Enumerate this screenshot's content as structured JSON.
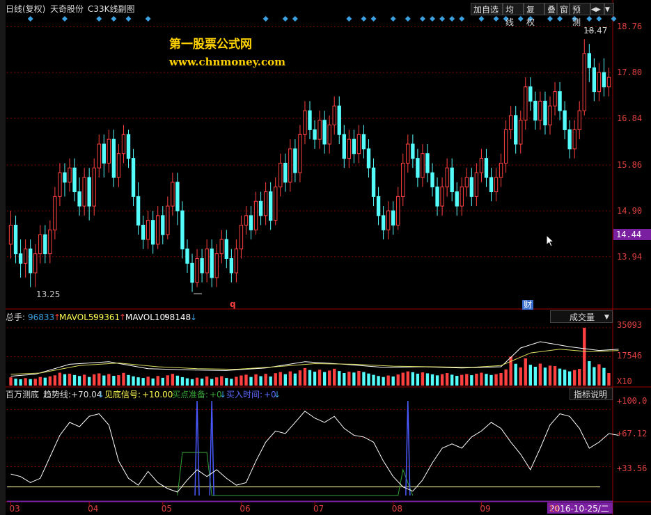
{
  "header": {
    "mode": "日线(复权)",
    "stock": "天奇股份",
    "indicator": "C33K线副图",
    "buttons": [
      "加自选",
      "均线",
      "复权",
      "叠",
      "窗",
      "预测"
    ],
    "nav_glyph": "◀▶"
  },
  "watermark": {
    "line1": "第一股票公式网",
    "line2": "www.chnmoney.com"
  },
  "price_axis": {
    "ticks": [
      "18.76",
      "17.80",
      "16.84",
      "15.86",
      "14.90",
      "13.94"
    ],
    "current": "14.44"
  },
  "annotations": {
    "high": "18.47",
    "low": "13.25",
    "q_mark": "q",
    "cai_mark": "财"
  },
  "volume_panel": {
    "label_total": "总手:",
    "total": "96833",
    "total_arrow": "↑",
    "ma5_label": "MAVOL5:",
    "ma5": "99361",
    "ma5_arrow": "↑",
    "ma10_label": "MAVOL10:",
    "ma10": "98148",
    "ma10_arrow": "↓",
    "dropdown": "成交量",
    "ticks": [
      "35093",
      "17546"
    ],
    "unit": "X10"
  },
  "indicator_panel": {
    "name": "百万测底",
    "trend_label": "趋势线:",
    "trend": "+70.04",
    "trend_arrow": "↓",
    "signal_label": "见底信号:",
    "signal": "+10.00",
    "ready_label": "买点准备:",
    "ready": "+0",
    "ready_arrow": "↓",
    "buy_label": "买入时间:",
    "buy": "+0",
    "buy_arrow": "↓",
    "help": "指标说明",
    "ticks": [
      "+100.0",
      "+67.12",
      "+33.56"
    ]
  },
  "time_axis": {
    "months": [
      "03",
      "04",
      "05",
      "06",
      "07",
      "08",
      "09",
      "10"
    ],
    "current_date": "2016-10-25/二"
  },
  "colors": {
    "up": "#ff4040",
    "down": "#54fcfc",
    "grid": "#7a0000",
    "signal": "#3ba0e0",
    "axis_text": "#e04040",
    "date_bg": "#7a1fa0"
  },
  "chart_data": {
    "type": "candlestick",
    "y_range": [
      12.9,
      19.0
    ],
    "price_ticks": [
      18.76,
      17.8,
      16.84,
      15.86,
      14.9,
      13.94
    ],
    "high": 18.47,
    "low": 13.25,
    "last": 14.44,
    "candles": [
      [
        14.2,
        14.6,
        14.9,
        13.9
      ],
      [
        14.6,
        14.0,
        14.8,
        13.8
      ],
      [
        14.0,
        13.8,
        14.3,
        13.5
      ],
      [
        13.8,
        14.1,
        14.3,
        13.5
      ],
      [
        14.1,
        13.6,
        14.3,
        13.3
      ],
      [
        13.6,
        14.0,
        14.2,
        13.3
      ],
      [
        14.0,
        14.4,
        14.6,
        13.8
      ],
      [
        14.4,
        14.0,
        14.6,
        13.8
      ],
      [
        14.0,
        14.5,
        14.7,
        13.8
      ],
      [
        14.5,
        15.2,
        15.4,
        14.3
      ],
      [
        15.2,
        15.7,
        15.9,
        15.0
      ],
      [
        15.7,
        15.5,
        15.9,
        15.2
      ],
      [
        15.5,
        15.8,
        16.0,
        15.3
      ],
      [
        15.8,
        15.3,
        16.0,
        15.1
      ],
      [
        15.3,
        15.0,
        15.6,
        14.8
      ],
      [
        15.0,
        15.6,
        15.8,
        14.8
      ],
      [
        15.6,
        15.0,
        15.8,
        14.7
      ],
      [
        15.0,
        15.8,
        16.0,
        14.8
      ],
      [
        15.8,
        16.3,
        16.5,
        15.6
      ],
      [
        16.3,
        15.9,
        16.5,
        15.6
      ],
      [
        15.9,
        16.4,
        16.6,
        15.7
      ],
      [
        16.4,
        15.6,
        16.6,
        15.4
      ],
      [
        15.6,
        16.1,
        16.3,
        15.4
      ],
      [
        16.1,
        16.5,
        16.7,
        15.9
      ],
      [
        16.5,
        16.0,
        16.6,
        15.8
      ],
      [
        16.0,
        15.2,
        16.2,
        15.0
      ],
      [
        15.2,
        14.6,
        15.5,
        14.4
      ],
      [
        14.6,
        14.3,
        14.8,
        14.1
      ],
      [
        14.3,
        14.7,
        14.9,
        14.1
      ],
      [
        14.7,
        14.2,
        14.9,
        14.0
      ],
      [
        14.2,
        14.8,
        15.0,
        14.1
      ],
      [
        14.8,
        14.4,
        15.0,
        14.2
      ],
      [
        14.4,
        15.0,
        15.2,
        14.3
      ],
      [
        15.0,
        15.5,
        15.7,
        14.8
      ],
      [
        15.5,
        14.9,
        15.7,
        14.6
      ],
      [
        14.9,
        14.1,
        15.1,
        13.9
      ],
      [
        14.1,
        13.8,
        14.3,
        13.6
      ],
      [
        13.8,
        13.4,
        14.0,
        13.2
      ],
      [
        13.4,
        13.9,
        14.1,
        13.3
      ],
      [
        13.9,
        13.6,
        14.1,
        13.4
      ],
      [
        13.6,
        14.1,
        14.3,
        13.4
      ],
      [
        14.1,
        13.5,
        14.3,
        13.3
      ],
      [
        13.5,
        14.0,
        14.2,
        13.3
      ],
      [
        14.0,
        14.3,
        14.5,
        13.8
      ],
      [
        14.3,
        13.9,
        14.5,
        13.7
      ],
      [
        13.9,
        13.6,
        14.1,
        13.4
      ],
      [
        13.6,
        14.1,
        14.3,
        13.4
      ],
      [
        14.1,
        14.6,
        14.8,
        13.9
      ],
      [
        14.6,
        14.8,
        15.0,
        14.4
      ],
      [
        14.8,
        14.5,
        15.0,
        14.3
      ],
      [
        14.5,
        15.1,
        15.3,
        14.4
      ],
      [
        15.1,
        14.8,
        15.3,
        14.6
      ],
      [
        14.8,
        15.3,
        15.5,
        14.6
      ],
      [
        15.3,
        14.7,
        15.5,
        14.5
      ],
      [
        14.7,
        15.4,
        15.6,
        14.6
      ],
      [
        15.4,
        15.9,
        16.1,
        15.2
      ],
      [
        15.9,
        15.5,
        16.1,
        15.3
      ],
      [
        15.5,
        16.2,
        16.4,
        15.3
      ],
      [
        16.2,
        15.7,
        16.4,
        15.5
      ],
      [
        15.7,
        16.5,
        16.7,
        15.5
      ],
      [
        16.5,
        17.0,
        17.2,
        16.3
      ],
      [
        17.0,
        16.6,
        17.2,
        16.4
      ],
      [
        16.6,
        16.4,
        16.8,
        16.2
      ],
      [
        16.4,
        16.8,
        17.0,
        16.2
      ],
      [
        16.8,
        16.3,
        17.0,
        16.1
      ],
      [
        16.3,
        16.7,
        16.9,
        16.1
      ],
      [
        16.7,
        17.1,
        17.3,
        16.5
      ],
      [
        17.1,
        16.5,
        17.3,
        16.3
      ],
      [
        16.5,
        16.0,
        16.7,
        15.8
      ],
      [
        16.0,
        16.4,
        16.6,
        15.8
      ],
      [
        16.4,
        16.1,
        16.6,
        15.9
      ],
      [
        16.1,
        16.5,
        16.7,
        15.9
      ],
      [
        16.5,
        16.2,
        16.7,
        16.0
      ],
      [
        16.2,
        15.8,
        16.4,
        15.6
      ],
      [
        15.8,
        15.2,
        16.0,
        15.0
      ],
      [
        15.2,
        14.8,
        15.4,
        14.6
      ],
      [
        14.8,
        14.5,
        15.0,
        14.3
      ],
      [
        14.5,
        14.9,
        15.1,
        14.3
      ],
      [
        14.9,
        14.6,
        15.1,
        14.4
      ],
      [
        14.6,
        15.2,
        15.4,
        14.5
      ],
      [
        15.2,
        15.9,
        16.1,
        15.0
      ],
      [
        15.9,
        16.3,
        16.5,
        15.7
      ],
      [
        16.3,
        16.0,
        16.5,
        15.8
      ],
      [
        16.0,
        15.6,
        16.2,
        15.4
      ],
      [
        15.6,
        16.1,
        16.3,
        15.4
      ],
      [
        16.1,
        15.7,
        16.3,
        15.5
      ],
      [
        15.7,
        15.4,
        15.9,
        15.2
      ],
      [
        15.4,
        15.0,
        15.6,
        14.8
      ],
      [
        15.0,
        15.4,
        15.6,
        14.8
      ],
      [
        15.4,
        15.8,
        16.0,
        15.2
      ],
      [
        15.8,
        15.3,
        16.0,
        15.1
      ],
      [
        15.3,
        15.0,
        15.5,
        14.8
      ],
      [
        15.0,
        15.4,
        15.6,
        14.8
      ],
      [
        15.4,
        15.6,
        15.8,
        15.2
      ],
      [
        15.6,
        15.2,
        15.8,
        15.0
      ],
      [
        15.2,
        15.7,
        15.9,
        15.0
      ],
      [
        15.7,
        16.0,
        16.2,
        15.5
      ],
      [
        16.0,
        15.6,
        16.2,
        15.4
      ],
      [
        15.6,
        15.3,
        15.8,
        15.1
      ],
      [
        15.3,
        15.6,
        15.8,
        15.1
      ],
      [
        15.6,
        15.9,
        16.1,
        15.4
      ],
      [
        15.9,
        16.6,
        16.8,
        15.7
      ],
      [
        16.6,
        16.9,
        17.1,
        16.4
      ],
      [
        16.9,
        16.3,
        17.1,
        16.1
      ],
      [
        16.3,
        16.8,
        17.0,
        16.1
      ],
      [
        16.8,
        17.5,
        17.7,
        16.6
      ],
      [
        17.5,
        17.2,
        17.7,
        17.0
      ],
      [
        17.2,
        16.8,
        17.4,
        16.6
      ],
      [
        16.8,
        17.2,
        17.4,
        16.6
      ],
      [
        17.2,
        16.7,
        17.4,
        16.5
      ],
      [
        16.7,
        17.1,
        17.3,
        16.5
      ],
      [
        17.1,
        17.4,
        17.6,
        16.9
      ],
      [
        17.4,
        17.0,
        17.6,
        16.8
      ],
      [
        17.0,
        16.6,
        17.2,
        16.4
      ],
      [
        16.6,
        16.2,
        16.8,
        16.0
      ],
      [
        16.2,
        16.6,
        16.8,
        16.0
      ],
      [
        16.6,
        17.0,
        17.2,
        16.4
      ],
      [
        17.0,
        18.2,
        18.5,
        16.9
      ],
      [
        18.2,
        17.9,
        18.4,
        17.6
      ],
      [
        17.9,
        17.4,
        18.1,
        17.2
      ],
      [
        17.4,
        17.8,
        18.0,
        17.2
      ],
      [
        17.8,
        17.5,
        18.1,
        17.3
      ],
      [
        17.5,
        17.7,
        17.9,
        17.3
      ]
    ],
    "volume": {
      "ticks": [
        35093,
        17546
      ],
      "unit": "X10",
      "y_max": 38000,
      "values": [
        5000,
        4200,
        3800,
        4500,
        3900,
        4100,
        5200,
        4800,
        5600,
        6200,
        7800,
        6900,
        7200,
        6400,
        5800,
        6600,
        5200,
        6800,
        7400,
        6100,
        7000,
        5900,
        6300,
        7700,
        6400,
        5600,
        5000,
        4600,
        5400,
        4300,
        5800,
        4700,
        6200,
        7100,
        6000,
        5100,
        4400,
        3900,
        4800,
        4200,
        5500,
        4000,
        5000,
        5700,
        4600,
        4100,
        5300,
        6100,
        6600,
        5200,
        6800,
        5700,
        7100,
        5500,
        7500,
        8200,
        6900,
        8600,
        7300,
        9200,
        10600,
        9400,
        8400,
        9600,
        8200,
        9100,
        10200,
        8800,
        7600,
        8400,
        7900,
        8900,
        8200,
        7300,
        6500,
        5800,
        5200,
        6100,
        5500,
        6700,
        7800,
        8600,
        8100,
        7200,
        8000,
        7400,
        6800,
        6200,
        6900,
        7600,
        6600,
        5900,
        6500,
        7000,
        6300,
        7200,
        7800,
        7100,
        6400,
        6900,
        7600,
        9800,
        17500,
        13200,
        11000,
        16500,
        12600,
        11400,
        13300,
        10900,
        12100,
        11800,
        10300,
        9600,
        8600,
        9400,
        10100,
        35093,
        14800,
        11200,
        12900,
        10700,
        7600
      ],
      "ma_points": [
        [
          0,
          0.85
        ],
        [
          5,
          0.82
        ],
        [
          12,
          0.66
        ],
        [
          20,
          0.62
        ],
        [
          28,
          0.73
        ],
        [
          36,
          0.75
        ],
        [
          44,
          0.76
        ],
        [
          52,
          0.72
        ],
        [
          60,
          0.62
        ],
        [
          68,
          0.66
        ],
        [
          76,
          0.71
        ],
        [
          84,
          0.7
        ],
        [
          92,
          0.72
        ],
        [
          100,
          0.7
        ],
        [
          104,
          0.4
        ],
        [
          108,
          0.3
        ],
        [
          114,
          0.38
        ],
        [
          120,
          0.44
        ],
        [
          124,
          0.42
        ]
      ],
      "ma2_points": [
        [
          0,
          0.82
        ],
        [
          6,
          0.8
        ],
        [
          14,
          0.68
        ],
        [
          22,
          0.64
        ],
        [
          30,
          0.7
        ],
        [
          38,
          0.73
        ],
        [
          46,
          0.74
        ],
        [
          54,
          0.7
        ],
        [
          62,
          0.65
        ],
        [
          70,
          0.66
        ],
        [
          78,
          0.69
        ],
        [
          86,
          0.7
        ],
        [
          94,
          0.71
        ],
        [
          100,
          0.68
        ],
        [
          106,
          0.48
        ],
        [
          112,
          0.42
        ],
        [
          118,
          0.46
        ],
        [
          124,
          0.44
        ]
      ]
    },
    "indicator": {
      "ticks": [
        100.0,
        67.12,
        33.56
      ],
      "y_range": [
        0,
        110
      ],
      "trend": [
        [
          0,
          25
        ],
        [
          2,
          22
        ],
        [
          4,
          15
        ],
        [
          6,
          20
        ],
        [
          8,
          45
        ],
        [
          10,
          70
        ],
        [
          12,
          85
        ],
        [
          14,
          80
        ],
        [
          16,
          92
        ],
        [
          18,
          95
        ],
        [
          20,
          82
        ],
        [
          22,
          40
        ],
        [
          24,
          20
        ],
        [
          26,
          12
        ],
        [
          28,
          28
        ],
        [
          30,
          15
        ],
        [
          32,
          8
        ],
        [
          34,
          4
        ],
        [
          36,
          18
        ],
        [
          38,
          30
        ],
        [
          40,
          22
        ],
        [
          42,
          30
        ],
        [
          44,
          20
        ],
        [
          46,
          12
        ],
        [
          48,
          15
        ],
        [
          50,
          40
        ],
        [
          52,
          62
        ],
        [
          54,
          75
        ],
        [
          56,
          72
        ],
        [
          58,
          85
        ],
        [
          60,
          98
        ],
        [
          62,
          90
        ],
        [
          64,
          85
        ],
        [
          66,
          92
        ],
        [
          68,
          78
        ],
        [
          70,
          70
        ],
        [
          72,
          68
        ],
        [
          74,
          62
        ],
        [
          76,
          40
        ],
        [
          78,
          22
        ],
        [
          80,
          10
        ],
        [
          82,
          5
        ],
        [
          84,
          18
        ],
        [
          86,
          38
        ],
        [
          88,
          55
        ],
        [
          90,
          60
        ],
        [
          92,
          55
        ],
        [
          94,
          68
        ],
        [
          96,
          75
        ],
        [
          98,
          85
        ],
        [
          100,
          78
        ],
        [
          102,
          62
        ],
        [
          104,
          48
        ],
        [
          106,
          30
        ],
        [
          108,
          55
        ],
        [
          110,
          82
        ],
        [
          112,
          95
        ],
        [
          114,
          92
        ],
        [
          116,
          78
        ],
        [
          118,
          55
        ],
        [
          120,
          62
        ],
        [
          122,
          72
        ],
        [
          124,
          70
        ]
      ],
      "blue_spikes": [
        [
          38,
          110
        ],
        [
          41,
          110
        ],
        [
          81,
          110
        ]
      ],
      "green_steps": [
        [
          34,
          0
        ],
        [
          35,
          50
        ],
        [
          38,
          50
        ],
        [
          40,
          50
        ],
        [
          41,
          0
        ],
        [
          79,
          0
        ],
        [
          80,
          30
        ],
        [
          82,
          0
        ]
      ],
      "baseline": 10
    },
    "month_positions": [
      [
        0,
        "03"
      ],
      [
        16,
        "04"
      ],
      [
        31,
        "05"
      ],
      [
        47,
        "06"
      ],
      [
        62,
        "07"
      ],
      [
        78,
        "08"
      ],
      [
        96,
        "09"
      ],
      [
        110,
        "10"
      ]
    ],
    "signal_diamonds": [
      4,
      11,
      18,
      21,
      24,
      28,
      52,
      56,
      58,
      69,
      72,
      74,
      78,
      81,
      84,
      86,
      88,
      90,
      92,
      96,
      99,
      101,
      104,
      106,
      110,
      112,
      115,
      118,
      120,
      123
    ]
  }
}
